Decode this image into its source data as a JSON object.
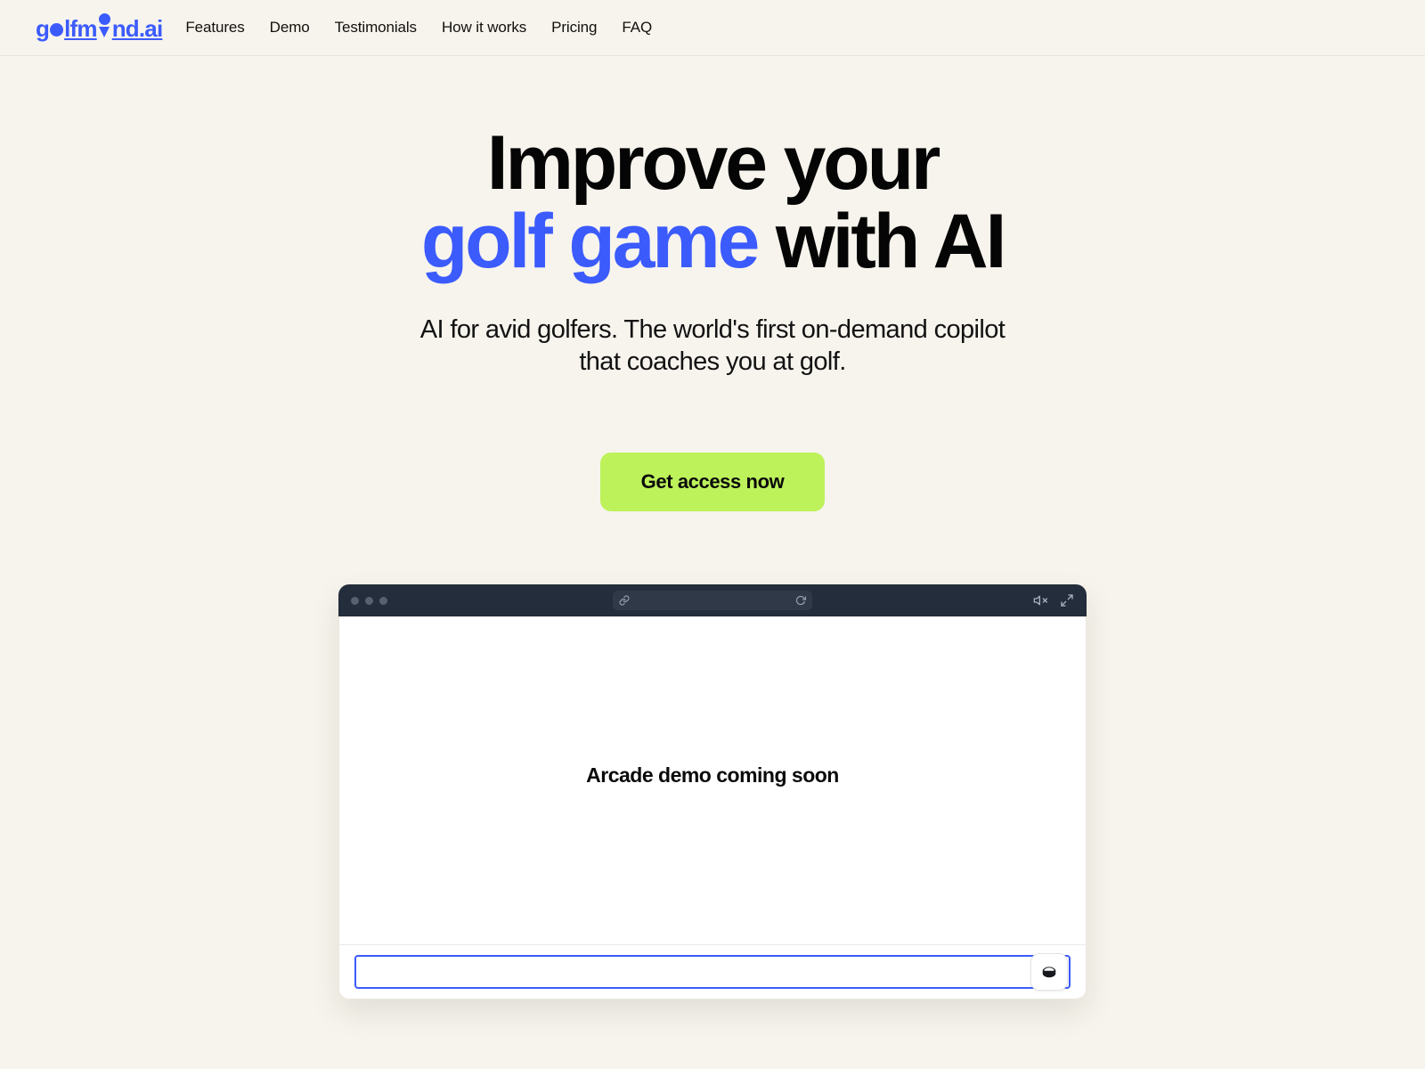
{
  "header": {
    "brand": {
      "part1": "g",
      "ball_icon": "golf-ball-icon",
      "part2": "lfm",
      "tee_icon": "golf-tee-icon",
      "part3": "nd.ai",
      "full_text": "golfmind.ai",
      "color": "#3b5bfd"
    },
    "nav": [
      {
        "label": "Features"
      },
      {
        "label": "Demo"
      },
      {
        "label": "Testimonials"
      },
      {
        "label": "How it works"
      },
      {
        "label": "Pricing"
      },
      {
        "label": "FAQ"
      }
    ]
  },
  "hero": {
    "title_line1": "Improve your",
    "title_line2_accent": "golf game",
    "title_line2_rest": " with AI",
    "subtitle": "AI for avid golfers. The world's first on-demand copilot that coaches you at golf.",
    "cta_label": "Get access now",
    "accent_color": "#3b5bfd",
    "cta_color": "#bdf25b"
  },
  "demo": {
    "chrome": {
      "traffic_lights": [
        "red-dot",
        "yellow-dot",
        "green-dot"
      ],
      "link_icon": "link-icon",
      "reload_icon": "reload-icon",
      "url_value": "",
      "url_placeholder": "",
      "mute_icon": "speaker-muted-icon",
      "fullscreen_icon": "expand-arrows-icon"
    },
    "placeholder_text": "Arcade demo coming soon",
    "input": {
      "value": "",
      "placeholder": ""
    },
    "password_manager_icon": "password-manager-icon"
  },
  "colors": {
    "page_background": "#f7f4ed",
    "chrome_background": "#232d3b",
    "text": "#0d0d0d"
  }
}
